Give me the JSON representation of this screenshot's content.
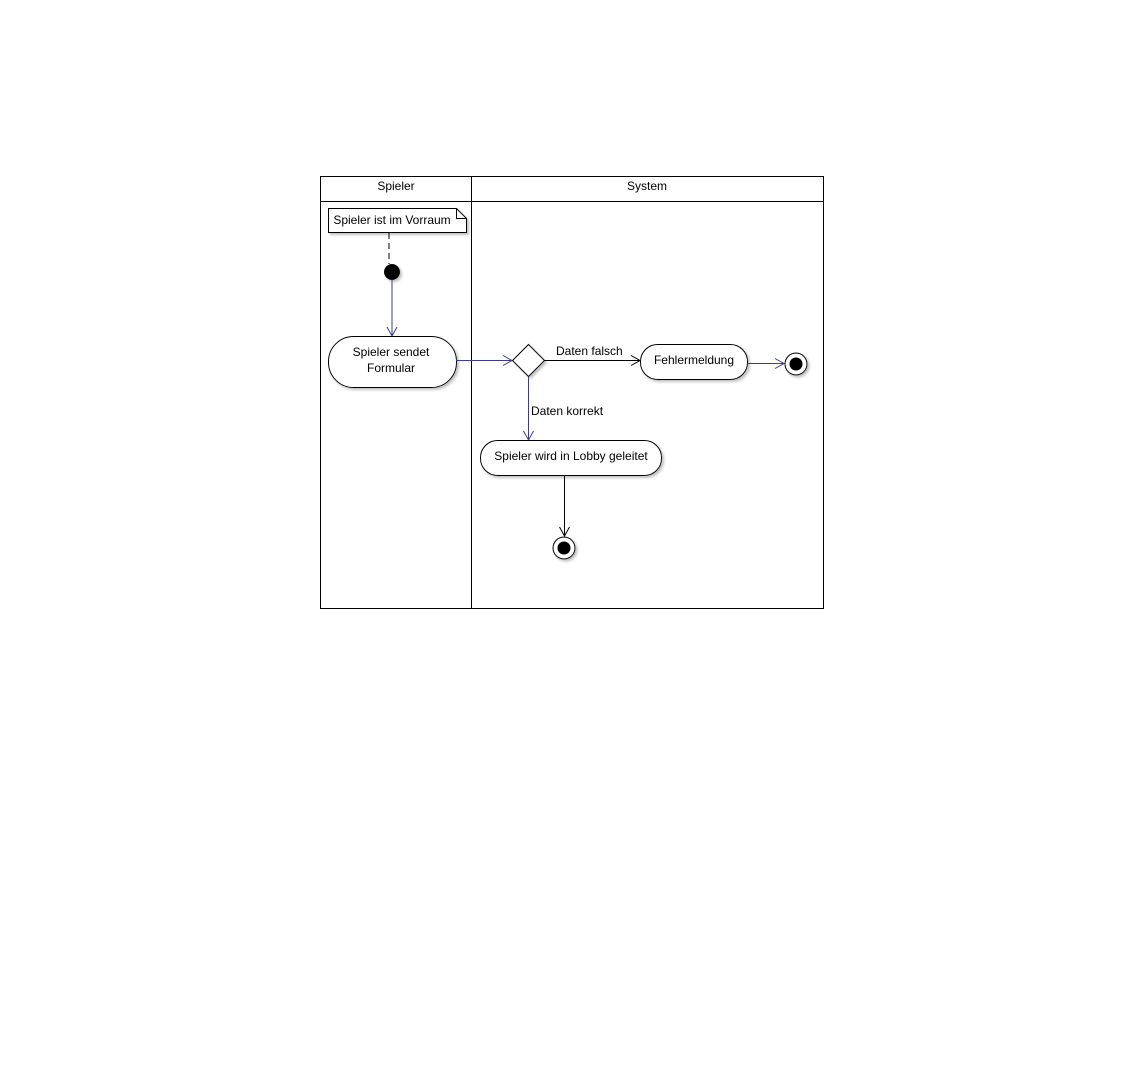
{
  "lanes": [
    {
      "label": "Spieler"
    },
    {
      "label": "System"
    }
  ],
  "note": {
    "text": "Spieler ist im Vorraum"
  },
  "actions": {
    "send_form": {
      "line1": "Spieler sendet",
      "line2": "Formular"
    },
    "error": {
      "text": "Fehlermeldung"
    },
    "lobby": {
      "text": "Spieler wird in Lobby geleitet"
    }
  },
  "guards": {
    "wrong": "Daten falsch",
    "correct": "Daten korrekt"
  },
  "colors": {
    "flow": "#3b3b8f",
    "outline": "#000000",
    "shadow": "#c8c8c8"
  }
}
